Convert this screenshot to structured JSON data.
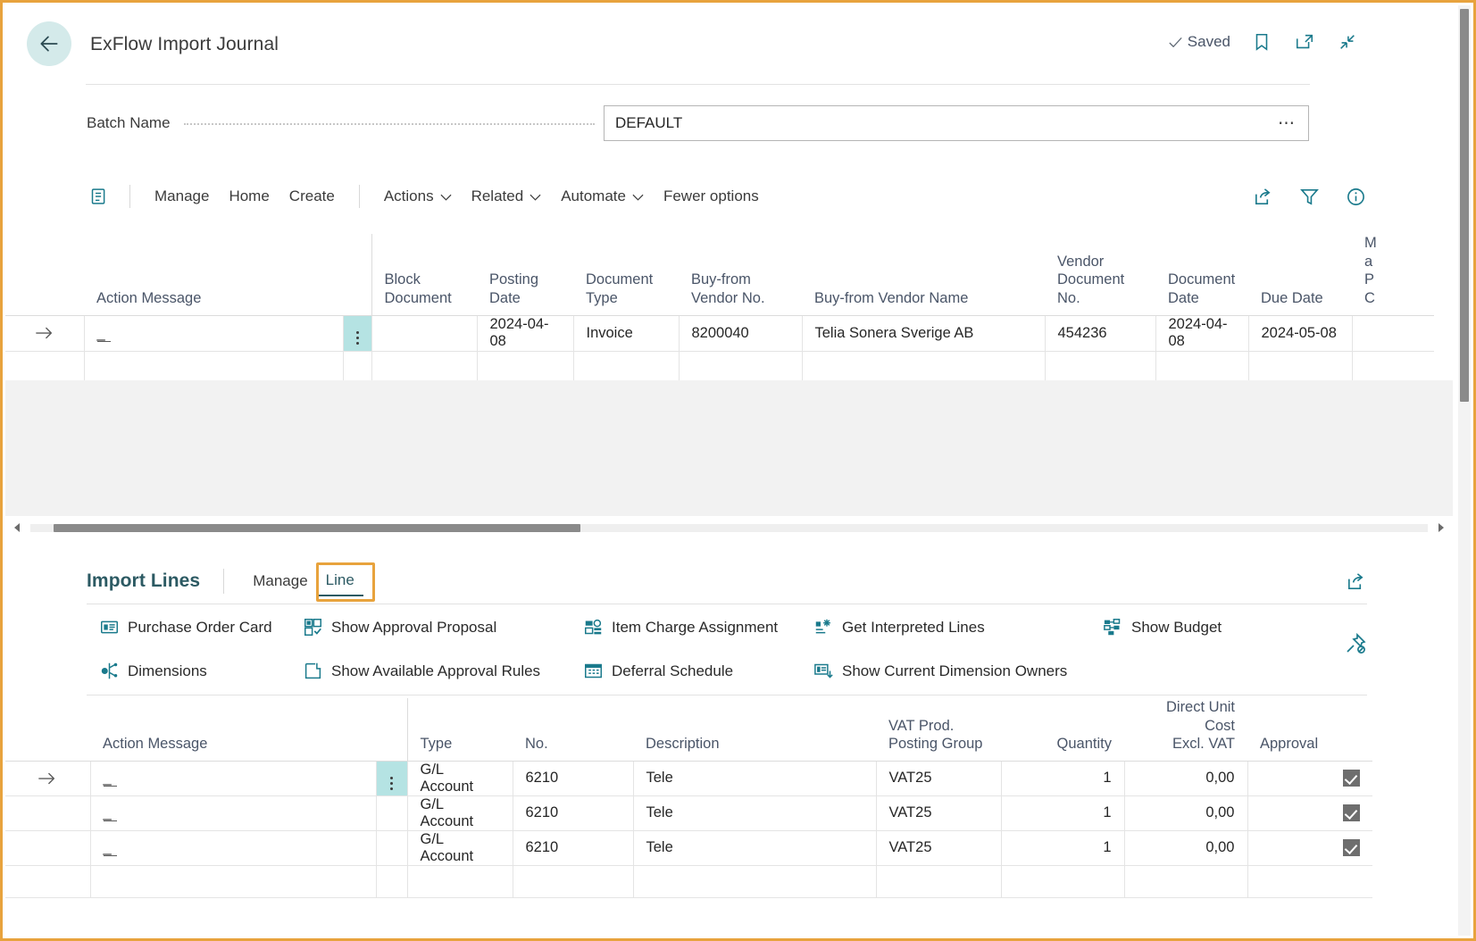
{
  "header": {
    "back_icon": "back-arrow-icon",
    "title": "ExFlow Import Journal",
    "saved_label": "Saved",
    "saved_icon": "checkmark-icon",
    "bookmark_icon": "bookmark-icon",
    "open_new_window_icon": "open-in-new-window-icon",
    "collapse_icon": "collapse-icon"
  },
  "batch": {
    "label": "Batch Name",
    "value": "DEFAULT",
    "placeholder": "",
    "ellipsis": "…"
  },
  "commandbar": {
    "grid_icon": "edit-in-grid-icon",
    "items": [
      {
        "label": "Manage",
        "has_chevron": false
      },
      {
        "label": "Home",
        "has_chevron": false
      },
      {
        "label": "Create",
        "has_chevron": false
      },
      {
        "label": "Actions",
        "has_chevron": true
      },
      {
        "label": "Related",
        "has_chevron": true
      },
      {
        "label": "Automate",
        "has_chevron": true
      },
      {
        "label": "Fewer options",
        "has_chevron": false
      }
    ],
    "right_icons": [
      {
        "name": "share-icon"
      },
      {
        "name": "filter-icon"
      },
      {
        "name": "info-icon"
      }
    ]
  },
  "top_grid": {
    "columns": [
      "Action Message",
      "Block Document",
      "Posting Date",
      "Document Type",
      "Buy-from Vendor No.",
      "Buy-from Vendor Name",
      "Vendor Document No.",
      "Document Date",
      "Due Date",
      "M a P C"
    ],
    "rows": [
      {
        "selected": true,
        "action_message": "_",
        "block_document": "",
        "posting_date": "2024-04-08",
        "document_type": "Invoice",
        "buy_from_vendor_no": "8200040",
        "buy_from_vendor_name": "Telia Sonera Sverige AB",
        "vendor_document_no": "454236",
        "document_date": "2024-04-08",
        "due_date": "2024-05-08",
        "extra": ""
      },
      {
        "selected": false,
        "action_message": "",
        "block_document": "",
        "posting_date": "",
        "document_type": "",
        "buy_from_vendor_no": "",
        "buy_from_vendor_name": "",
        "vendor_document_no": "",
        "document_date": "",
        "due_date": "",
        "extra": ""
      }
    ]
  },
  "import_lines": {
    "title": "Import Lines",
    "tabs": [
      {
        "label": "Manage",
        "active": false
      },
      {
        "label": "Line",
        "active": true,
        "highlighted": true
      }
    ],
    "share_icon": "share-icon",
    "pin_icon": "unpin-icon",
    "actions": [
      {
        "label": "Purchase Order Card",
        "icon": "purchase-order-card-icon"
      },
      {
        "label": "Show Approval Proposal",
        "icon": "approval-proposal-icon"
      },
      {
        "label": "Item Charge Assignment",
        "icon": "item-charge-icon"
      },
      {
        "label": "Get Interpreted Lines",
        "icon": "interpreted-lines-icon"
      },
      {
        "label": "Show Budget",
        "icon": "budget-icon"
      },
      {
        "label": "Dimensions",
        "icon": "dimensions-icon"
      },
      {
        "label": "Show Available Approval Rules",
        "icon": "approval-rules-icon"
      },
      {
        "label": "Deferral Schedule",
        "icon": "deferral-schedule-icon"
      },
      {
        "label": "Show Current Dimension Owners",
        "icon": "dimension-owners-icon"
      }
    ],
    "columns": [
      "Action Message",
      "Type",
      "No.",
      "Description",
      "VAT Prod. Posting Group",
      "Quantity",
      "Direct Unit Cost Excl. VAT",
      "Approval"
    ],
    "rows": [
      {
        "selected": true,
        "action_message": "_",
        "type": "G/L Account",
        "no": "6210",
        "description": "Tele",
        "vat_prod_posting_group": "VAT25",
        "quantity": "1",
        "direct_unit_cost": "0,00",
        "approval": true
      },
      {
        "selected": false,
        "action_message": "_",
        "type": "G/L Account",
        "no": "6210",
        "description": "Tele",
        "vat_prod_posting_group": "VAT25",
        "quantity": "1",
        "direct_unit_cost": "0,00",
        "approval": true
      },
      {
        "selected": false,
        "action_message": "_",
        "type": "G/L Account",
        "no": "6210",
        "description": "Tele",
        "vat_prod_posting_group": "VAT25",
        "quantity": "1",
        "direct_unit_cost": "0,00",
        "approval": true
      },
      {
        "selected": false,
        "action_message": "",
        "type": "",
        "no": "",
        "description": "",
        "vat_prod_posting_group": "",
        "quantity": "",
        "direct_unit_cost": "",
        "approval": false
      }
    ]
  },
  "scrollbars": {
    "horizontal_left_arrow": "chevron-left-icon",
    "horizontal_right_arrow": "chevron-right-icon"
  },
  "colors": {
    "accent_teal": "#1A7A8C",
    "title_teal": "#2C5A63",
    "highlight_orange": "#E8A33D",
    "selection_cyan": "#B5E3E3",
    "back_button_bg": "#D4EAEA"
  }
}
